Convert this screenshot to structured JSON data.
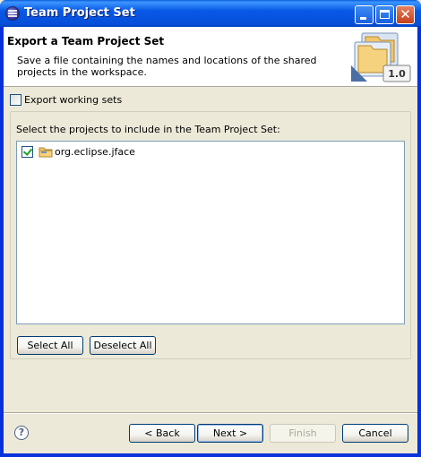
{
  "window": {
    "title": "Team Project Set",
    "title_icon": "eclipse-icon",
    "controls": [
      "minimize-icon",
      "maximize-icon",
      "close-icon"
    ]
  },
  "header": {
    "title": "Export a Team Project Set",
    "description": "Save a file containing the names and locations of the shared projects in the workspace.",
    "banner_version": "1.0"
  },
  "options": {
    "export_working_sets": {
      "label": "Export working sets",
      "checked": false
    }
  },
  "projects": {
    "label": "Select the projects to include in the Team Project Set:",
    "items": [
      {
        "label": "org.eclipse.jface",
        "checked": true,
        "icon": "project-folder-icon"
      }
    ]
  },
  "selection_buttons": {
    "select_all": "Select All",
    "deselect_all": "Deselect All"
  },
  "footer": {
    "help_icon": "help-icon",
    "back": "< Back",
    "next": "Next >",
    "finish": "Finish",
    "cancel": "Cancel"
  },
  "colors": {
    "titlebar": "#0858e6",
    "dialog_bg": "#ece9d8",
    "button_border": "#003c74",
    "check_green": "#21a121"
  }
}
